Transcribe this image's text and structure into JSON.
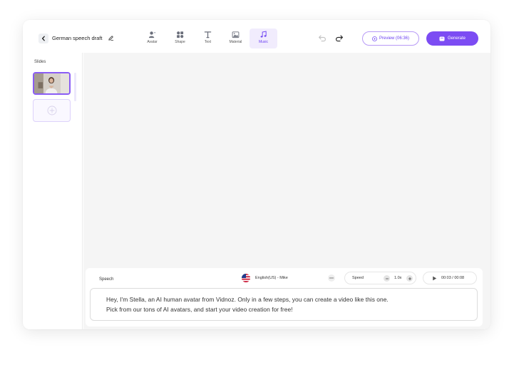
{
  "header": {
    "project_title": "German speech draft",
    "tools": [
      {
        "label": "Avatar",
        "icon": "avatar-icon"
      },
      {
        "label": "Shape",
        "icon": "shape-icon"
      },
      {
        "label": "Text",
        "icon": "text-icon"
      },
      {
        "label": "Material",
        "icon": "material-icon"
      },
      {
        "label": "Music",
        "icon": "music-icon",
        "active": true
      }
    ],
    "preview_label": "Preview (06:36)",
    "generate_label": "Generate"
  },
  "sidebar": {
    "slides_label": "Slides"
  },
  "speech": {
    "label": "Speech",
    "voice": "English(US) - Mike",
    "speed_label": "Speed",
    "speed_value": "1.0x",
    "time": "00:03 / 00:08",
    "script_lines": [
      "Hey, I'm Stella, an AI human avatar from Vidnoz. Only in a few steps, you can create a video like this one.",
      "Pick from our tons of AI avatars, and start your video creation for free!"
    ]
  },
  "colors": {
    "accent": "#7c4cf3",
    "canvas": "#f5f5f5"
  }
}
